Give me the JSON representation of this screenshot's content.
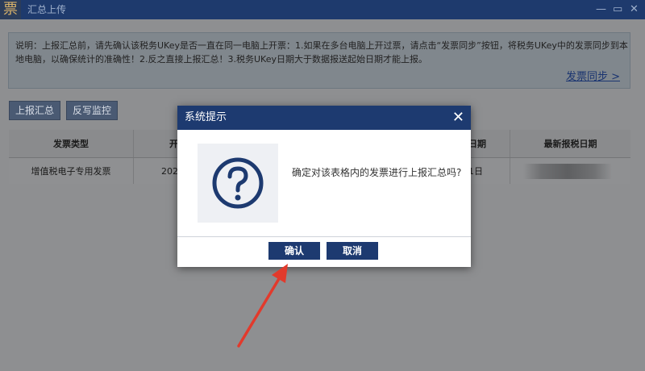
{
  "titlebar": {
    "logo_char": "票",
    "title": "汇总上传",
    "controls": [
      "—",
      "▭",
      "✕"
    ]
  },
  "notice": {
    "text": "说明：上报汇总前，请先确认该税务UKey是否一直在同一电脑上开票：1.如果在多台电脑上开过票，请点击“发票同步”按钮，将税务UKey中的发票同步到本地电脑，以确保统计的准确性！2.反之直接上报汇总！3.税务UKey日期大于数据报送起始日期才能上报。",
    "sync_link": "发票同步 >"
  },
  "toolbar": {
    "report_btn": "上报汇总",
    "monitor_btn": "反写监控"
  },
  "table": {
    "headers": [
      "发票类型",
      "开",
      "日期",
      "最新报税日期"
    ],
    "row": [
      "增值税电子专用发票",
      "202",
      "1日",
      ""
    ]
  },
  "dialog": {
    "title": "系统提示",
    "close": "✕",
    "message": "确定对该表格内的发票进行上报汇总吗?",
    "confirm": "确认",
    "cancel": "取消",
    "icon": "question-circle-icon"
  },
  "colors": {
    "titlebar": "#1e3a6d",
    "dialog_header": "#1d3a70",
    "arrow": "#e23a2c"
  }
}
